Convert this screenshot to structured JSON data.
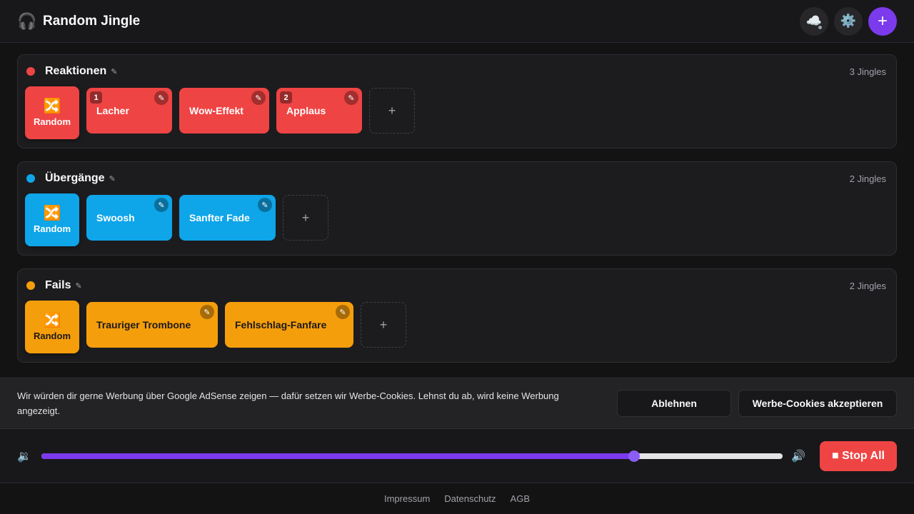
{
  "header": {
    "logo_icon": "🎧",
    "title": "Random Jingle",
    "cloud_icon": "☁️",
    "settings_icon": "⚙️",
    "add_icon": "+"
  },
  "categories": [
    {
      "name": "Reaktionen",
      "color": "#ef4444",
      "count": "3 Jingles",
      "random_label": "Random",
      "jingles": [
        {
          "label": "Lacher",
          "hotkey": "1"
        },
        {
          "label": "Wow-Effekt",
          "hotkey": ""
        },
        {
          "label": "Applaus",
          "hotkey": "2"
        }
      ]
    },
    {
      "name": "Übergänge",
      "color": "#0ea5e9",
      "count": "2 Jingles",
      "random_label": "Random",
      "jingles": [
        {
          "label": "Swoosh",
          "hotkey": ""
        },
        {
          "label": "Sanfter Fade",
          "hotkey": ""
        }
      ]
    },
    {
      "name": "Fails",
      "color": "#f59e0b",
      "count": "2 Jingles",
      "random_label": "Random",
      "jingles": [
        {
          "label": "Trauriger Trombone",
          "hotkey": ""
        },
        {
          "label": "Fehlschlag-Fanfare",
          "hotkey": ""
        }
      ]
    }
  ],
  "icons": {
    "edit": "✎",
    "random": "🔀",
    "add": "+"
  },
  "cookie": {
    "text": "Wir würden dir gerne Werbung über Google AdSense zeigen — dafür setzen wir Werbe-Cookies. Lehnst du ab, wird keine Werbung angezeigt.",
    "decline": "Ablehnen",
    "accept": "Werbe-Cookies akzeptieren"
  },
  "player": {
    "volume_low_icon": "🔉",
    "volume_high_icon": "🔊",
    "volume": 0.8,
    "stop_label": "■ Stop All"
  },
  "footer": {
    "links": [
      "Impressum",
      "Datenschutz",
      "AGB"
    ]
  }
}
